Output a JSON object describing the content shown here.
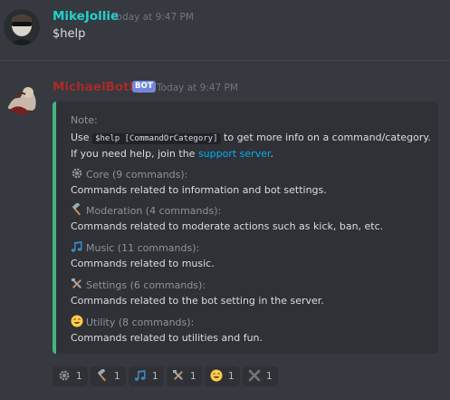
{
  "messages": [
    {
      "author": "MikeJollie",
      "author_color": "#1fd1cd",
      "timestamp": "Today at 9:47 PM",
      "content": "$help"
    },
    {
      "author": "MichaelBotPy",
      "author_color": "#a82a2a",
      "badge": "BOT",
      "timestamp": "Today at 9:47 PM"
    }
  ],
  "embed": {
    "accent_color": "#43b581",
    "note_title": "Note:",
    "note_prefix": "Use",
    "note_code": "$help [CommandOrCategory]",
    "note_suffix": "to get more info on a command/category.",
    "help_prefix": "If you need help, join the",
    "help_link": "support server",
    "help_suffix": ".",
    "fields": [
      {
        "icon": "gear-icon",
        "name": "Core (9 commands):",
        "value": "Commands related to information and bot settings."
      },
      {
        "icon": "hammer-icon",
        "name": "Moderation (4 commands):",
        "value": "Commands related to moderate actions such as kick, ban, etc."
      },
      {
        "icon": "music-note-icon",
        "name": "Music (11 commands):",
        "value": "Commands related to music."
      },
      {
        "icon": "tools-icon",
        "name": "Settings (6 commands):",
        "value": "Commands related to the bot setting in the server."
      },
      {
        "icon": "smile-icon",
        "name": "Utility (8 commands):",
        "value": "Commands related to utilities and fun."
      }
    ]
  },
  "reactions": [
    {
      "icon": "gear-icon",
      "count": "1"
    },
    {
      "icon": "hammer-icon",
      "count": "1"
    },
    {
      "icon": "music-note-icon",
      "count": "1"
    },
    {
      "icon": "tools-icon",
      "count": "1"
    },
    {
      "icon": "smile-icon",
      "count": "1"
    },
    {
      "icon": "close-x-icon",
      "count": "1"
    }
  ]
}
